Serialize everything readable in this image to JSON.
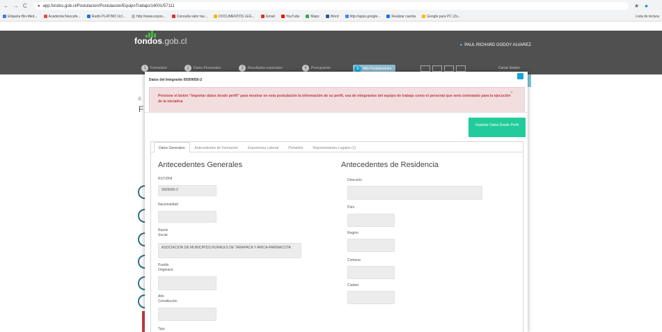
{
  "browser": {
    "nav_back": "←",
    "nav_forward": "→",
    "nav_reload": "C",
    "url": "app.fondos.gob.cl/Postulacion/Postulacion/EquipoTrabajo/14001/57111",
    "bookmarks": [
      {
        "label": "Etiqueta Bio-Med...",
        "color": "#3b7ddd"
      },
      {
        "label": "Academia Nescafe...",
        "color": "#e34d3c"
      },
      {
        "label": "Radio PLATINO Ucl...",
        "color": "#1a73e8"
      },
      {
        "label": "http://www.expos...",
        "color": "#bbbbbb"
      },
      {
        "label": "Consulta valor tas...",
        "color": "#d93025"
      },
      {
        "label": "DOCUMENTOS LEG...",
        "color": "#f4b400"
      },
      {
        "label": "Gmail",
        "color": "#d93025"
      },
      {
        "label": "YouTube",
        "color": "#ff0000"
      },
      {
        "label": "Maps",
        "color": "#34a853"
      },
      {
        "label": "Word",
        "color": "#2b579a"
      },
      {
        "label": "http://apps.google...",
        "color": "#4285f4"
      },
      {
        "label": "Realizar cuenta",
        "color": "#1a73e8"
      },
      {
        "label": "Google para PC (Zo...",
        "color": "#fbbc05"
      }
    ],
    "bookmarks_other": "Lista de lectura"
  },
  "header": {
    "logo_main": "fondos",
    "logo_suffix": ".gob.cl",
    "user_name": "PAUL RICHARD GODOY ALVAREZ"
  },
  "steps": [
    {
      "num": "1",
      "label": "Formulario"
    },
    {
      "num": "2",
      "label": "Datos Personales"
    },
    {
      "num": "3",
      "label": "Resultados esperados"
    },
    {
      "num": "4",
      "label": "Presupuesto"
    },
    {
      "num": "5",
      "label": "Mis Postulaciones"
    }
  ],
  "close_session": "Cerrar Sesión",
  "background": {
    "small_text": "E",
    "initial": "F"
  },
  "modal": {
    "title": "Datos del Integrante 09309050-2",
    "alert": "Presione el botón \"Importar datos desde perfil\" para mostrar en esta postulación la información de su perfil, sea de integrantes del equipo de trabajo como el personal que será contratado para la ejecución de la iniciativa",
    "alert_close": "×",
    "import_button": "Importar Datos Desde Perfil",
    "tabs": [
      "Datos Generales",
      "Antecedentes de Formación",
      "Experiencia Laboral",
      "Portafolio",
      "Representantes Legales (1)"
    ],
    "general": {
      "title": "Antecedentes Generales",
      "rut_label": "RUT/DNI",
      "rut_value": "9309050-2",
      "nacionalidad_label": "Nacionalidad",
      "razon_social_label": "Razón Social",
      "razon_social_value": "ASOCIACION DE MUNICIPIOS RURALES DE TARAPACA Y ARICA-PARINACOTA",
      "pueblo_label": "Pueblo Originario",
      "ano_label": "Año Constitución",
      "tipo_label": "Tipo"
    },
    "residencia": {
      "title": "Antecedentes de Residencia",
      "direccion_label": "Dirección",
      "pais_label": "País",
      "region_label": "Región",
      "comuna_label": "Comuna",
      "ciudad_label": "Ciudad"
    }
  }
}
